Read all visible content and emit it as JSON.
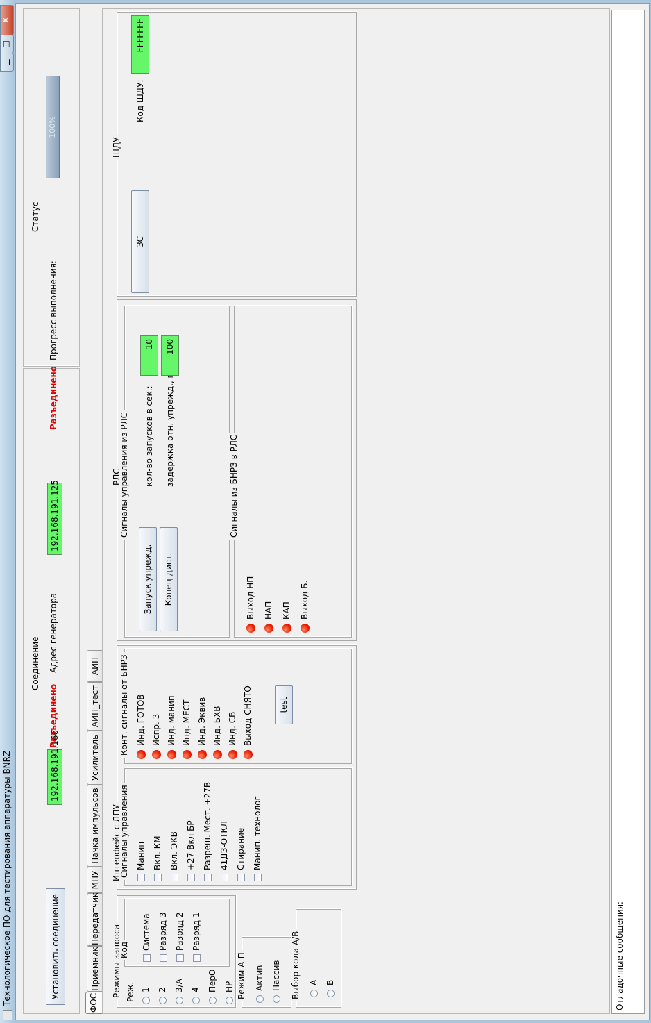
{
  "window": {
    "title": "Технологическое ПО для тестирования аппаратуры BNRZ",
    "minimize": "▁",
    "maximize": "□",
    "close": "X"
  },
  "connection": {
    "group_title": "Соединение",
    "connect_button": "Установить соединение",
    "ip_local": "192.168.191.166",
    "status_local": "Разъединено",
    "generator_label": "Адрес генератора",
    "generator_ip": "192.168.191.125",
    "status_generator": "Разъединено"
  },
  "status": {
    "group_title": "Статус",
    "progress_label": "Прогресс выполнения:",
    "progress_value": "100%",
    "progress_fraction": 1.0
  },
  "tabs": [
    "ФОС",
    "Приемник",
    "Передатчик",
    "МПУ",
    "Пачка импульсов",
    "Усилитель",
    "АИП_тест",
    "АИП"
  ],
  "fos": {
    "request_modes": {
      "title": "Режимы запроса",
      "mode_title": "Реж.",
      "modes": [
        "1",
        "2",
        "3/А",
        "4",
        "ПерО",
        "НР"
      ],
      "code_title": "Код",
      "codes": [
        "Система",
        "Разряд 3",
        "Разряд 2",
        "Разряд 1"
      ]
    },
    "ap_mode": {
      "title": "Режим А-П",
      "options": [
        "Актив",
        "Пассив"
      ]
    },
    "ab_code": {
      "title": "Выбор кода А/В",
      "options": [
        "А",
        "В"
      ]
    },
    "dpu": {
      "title": "Интерфейс с ДПУ",
      "control_title": "Сигналы управления",
      "control": [
        "Манип",
        "Вкл. КМ",
        "Вкл. ЭКВ",
        "+27 Вкл БР",
        "Разреш. Мест. +27В",
        "41ДЗ-ОТКЛ",
        "Стирание",
        "Манип. технолог"
      ],
      "bnrz_title": "Конт. сигналы от БНРЗ",
      "bnrz": [
        "Инд. ГОТОВ",
        "Испр. 3",
        "Инд. манип",
        "Инд. МЕСТ",
        "Инд. Эквив",
        "Инд. БХВ",
        "Инд. СВ",
        "Выход СНЯТО"
      ],
      "test_button": "test"
    },
    "rls": {
      "title": "РЛС",
      "ctrl_title": "Сигналы управления из РЛС",
      "start_button": "Запуск упрежд.",
      "end_button": "Конец дист.",
      "count_label": "кол-во запусков в сек.:",
      "count_value": "10",
      "delay_label": "задержка отн. упрежд., мкс.:",
      "delay_value": "100",
      "bnrz_title": "Сигналы из БНРЗ в РЛС",
      "bnrz": [
        "Выход НП",
        "НАП",
        "КАП",
        "Выход Б."
      ]
    },
    "shdu": {
      "title": "ШДУ",
      "zs_button": "ЗС",
      "code_label": "Код ШДУ:",
      "code_value": "FFFFFFF"
    }
  },
  "messages": {
    "label": "Отладочные сообщения:"
  }
}
